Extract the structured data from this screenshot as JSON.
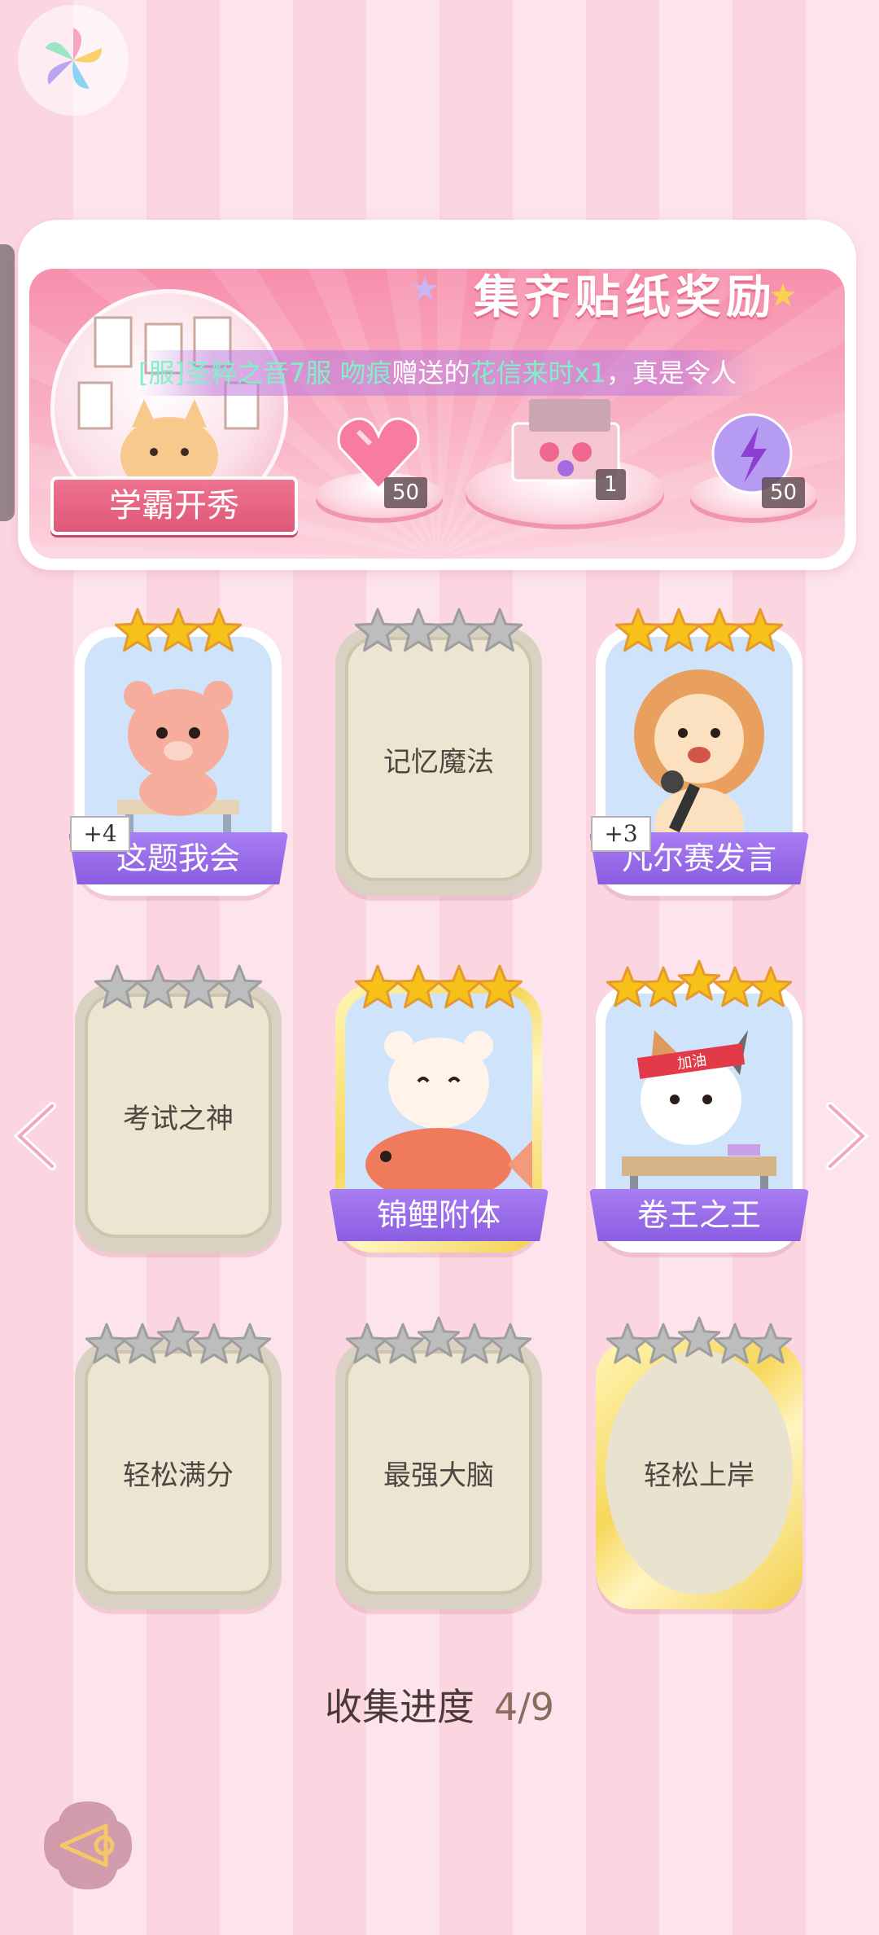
{
  "header": {
    "logo_icon": "pinwheel-logo-icon"
  },
  "banner": {
    "title": "集齐贴纸奖励",
    "ticker_prefix": "[",
    "ticker_server": "服]圣粹之音7服 ",
    "ticker_user": "吻痕",
    "ticker_mid": "赠送的",
    "ticker_gift": "花信来时x1",
    "ticker_suffix": "，真是令人",
    "scene_label": "学霸开秀",
    "rewards": [
      {
        "item": "pink-heart-gem",
        "qty": "50"
      },
      {
        "item": "gift-box",
        "qty": "1"
      },
      {
        "item": "purple-energy-orb",
        "qty": "50"
      }
    ]
  },
  "cards": [
    {
      "name": "这题我会",
      "stars_total": 3,
      "stars_lit": 3,
      "collected": true,
      "plus": "+4",
      "art": "bear-at-desk"
    },
    {
      "name": "记忆魔法",
      "stars_total": 4,
      "stars_lit": 0,
      "collected": false
    },
    {
      "name": "凡尔赛发言",
      "stars_total": 4,
      "stars_lit": 4,
      "collected": true,
      "plus": "+3",
      "art": "lion-with-mic"
    },
    {
      "name": "考试之神",
      "stars_total": 4,
      "stars_lit": 0,
      "collected": false
    },
    {
      "name": "锦鲤附体",
      "stars_total": 4,
      "stars_lit": 4,
      "collected": true,
      "art": "bear-with-koi"
    },
    {
      "name": "卷王之王",
      "stars_total": 5,
      "stars_lit": 5,
      "collected": true,
      "art": "cat-studying"
    },
    {
      "name": "轻松满分",
      "stars_total": 5,
      "stars_lit": 0,
      "collected": false
    },
    {
      "name": "最强大脑",
      "stars_total": 5,
      "stars_lit": 0,
      "collected": false
    },
    {
      "name": "轻松上岸",
      "stars_total": 5,
      "stars_lit": 0,
      "collected": false
    }
  ],
  "cat_headband_text": "加油",
  "progress": {
    "label": "收集进度",
    "value": "4/9"
  },
  "colors": {
    "ribbon": "#8a5ee0",
    "star_gold": "#f6c21a",
    "star_gray": "#bdbdbd",
    "bg_stripe": "#fbd6e0"
  }
}
